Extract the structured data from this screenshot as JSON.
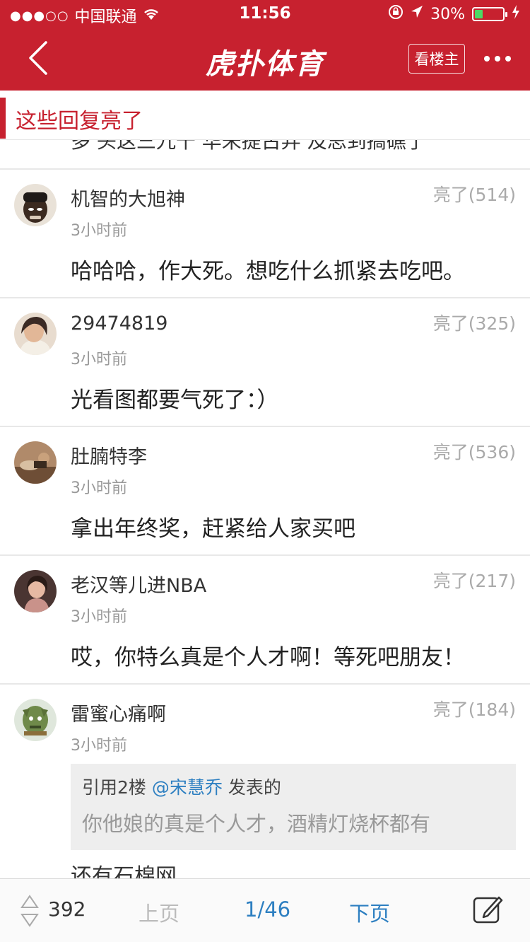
{
  "status_bar": {
    "carrier": "中国联通",
    "time": "11:56",
    "battery_percent": "30%",
    "battery_level": 0.3
  },
  "nav": {
    "logo": "虎扑体育",
    "op_button": "看楼主"
  },
  "section": {
    "title": "这些回复亮了"
  },
  "cut_top_text": "多 头这三九千 华未提古弄 及思到搞礁了",
  "comments": [
    {
      "user": "机智的大旭神",
      "time": "3小时前",
      "likes": "亮了(514)",
      "text": "哈哈哈，作大死。想吃什么抓紧去吃吧。"
    },
    {
      "user": "29474819",
      "time": "3小时前",
      "likes": "亮了(325)",
      "text": "光看图都要气死了：）"
    },
    {
      "user": "肚腩特李",
      "time": "3小时前",
      "likes": "亮了(536)",
      "text": "拿出年终奖，赶紧给人家买吧"
    },
    {
      "user": "老汉等儿进NBA",
      "time": "3小时前",
      "likes": "亮了(217)",
      "text": "哎，你特么真是个人才啊！等死吧朋友！"
    },
    {
      "user": "雷蜜心痛啊",
      "time": "3小时前",
      "likes": "亮了(184)",
      "quote": {
        "prefix": "引用2楼 ",
        "user": "@宋慧乔",
        "suffix": " 发表的",
        "text": "你他娘的真是个人才，酒精灯烧杯都有"
      },
      "partial": "还有石棉网"
    }
  ],
  "bottom": {
    "vote_count": "392",
    "prev": "上页",
    "page": "1/46",
    "next": "下页"
  },
  "colors": {
    "brand_red": "#c7212f",
    "link_blue": "#2d7fc1"
  }
}
